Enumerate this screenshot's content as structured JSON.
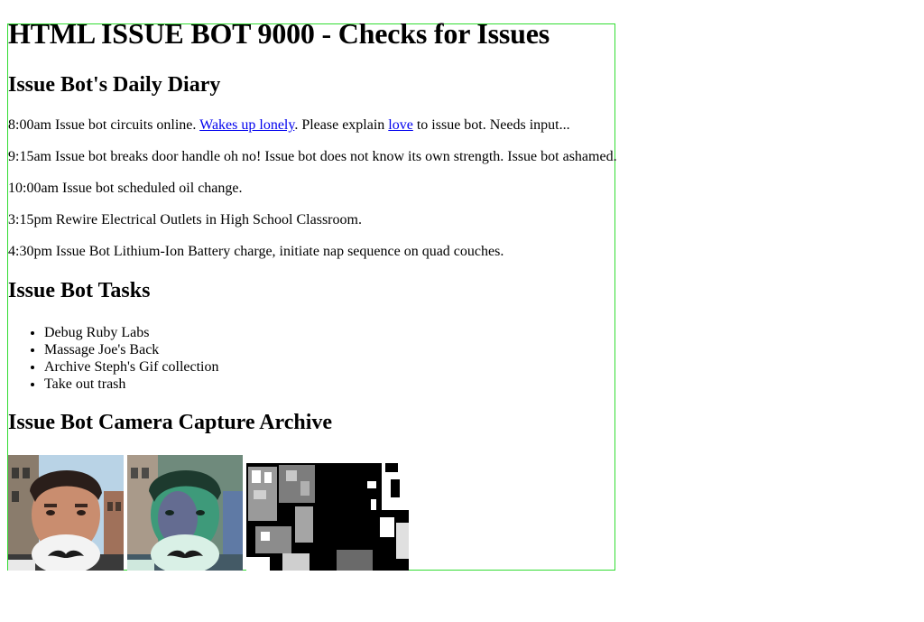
{
  "page": {
    "title": "HTML ISSUE BOT 9000 - Checks for Issues"
  },
  "diary": {
    "heading": "Issue Bot's Daily Diary",
    "entries": [
      {
        "before": "8:00am Issue bot circuits online. ",
        "link1": "Wakes up lonely",
        "middle": ". Please explain ",
        "link2": "love",
        "after": " to issue bot. Needs input..."
      },
      {
        "text": "9:15am Issue bot breaks door handle oh no! Issue bot does not know its own strength. Issue bot ashamed."
      },
      {
        "text": "10:00am Issue bot scheduled oil change."
      },
      {
        "text": "3:15pm Rewire Electrical Outlets in High School Classroom."
      },
      {
        "text": "4:30pm Issue Bot Lithium-Ion Battery charge, initiate nap sequence on quad couches."
      }
    ]
  },
  "tasks": {
    "heading": "Issue Bot Tasks",
    "items": [
      "Debug Ruby Labs",
      "Massage Joe's Back",
      "Archive Steph's Gif collection",
      "Take out trash"
    ]
  },
  "camera": {
    "heading": "Issue Bot Camera Capture Archive",
    "photos": [
      {
        "name": "photo-selfie-original"
      },
      {
        "name": "photo-selfie-inverted"
      },
      {
        "name": "photo-selfie-threshold"
      }
    ]
  },
  "colors": {
    "border": "#33dd33",
    "link": "#0000ee",
    "text": "#000000"
  }
}
